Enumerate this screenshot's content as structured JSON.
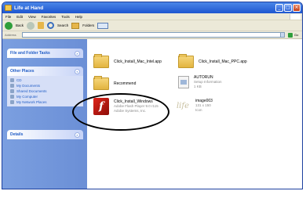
{
  "window": {
    "title": "Life at Hand"
  },
  "menu": [
    "File",
    "Edit",
    "View",
    "Favorites",
    "Tools",
    "Help"
  ],
  "toolbar": {
    "back_label": "Back",
    "search_label": "Search",
    "folders_label": "Folders"
  },
  "address": {
    "label": "Address",
    "go_label": "Go"
  },
  "sidebar": {
    "file_tasks": {
      "title": "File and Folder Tasks"
    },
    "other_places": {
      "title": "Other Places",
      "items": [
        "CD",
        "My Documents",
        "Shared Documents",
        "My Computer",
        "My Network Places"
      ]
    },
    "details": {
      "title": "Details"
    }
  },
  "files": [
    {
      "name": "Click_Install_Mac_Intel.app",
      "sub1": "",
      "sub2": "",
      "icon": "folder-icon"
    },
    {
      "name": "Click_Install_Mac_PPC.app",
      "sub1": "",
      "sub2": "",
      "icon": "folder-icon"
    },
    {
      "name": "Recommend",
      "sub1": "",
      "sub2": "",
      "icon": "folder-icon"
    },
    {
      "name": "AUTORUN",
      "sub1": "Setup Information",
      "sub2": "1 KB",
      "icon": "setup-file-icon"
    },
    {
      "name": "Click_Install_Windows",
      "sub1": "Adobe Flash Player 9.0 r115",
      "sub2": "Adobe Systems, Inc.",
      "icon": "flash-icon"
    },
    {
      "name": "image003",
      "sub1": "131 x 150",
      "sub2": "Icon",
      "icon": "image-icon"
    }
  ],
  "colors": {
    "title_bar": "#1e56d0",
    "sidebar": "#6b8fd6",
    "link": "#215dc6"
  }
}
